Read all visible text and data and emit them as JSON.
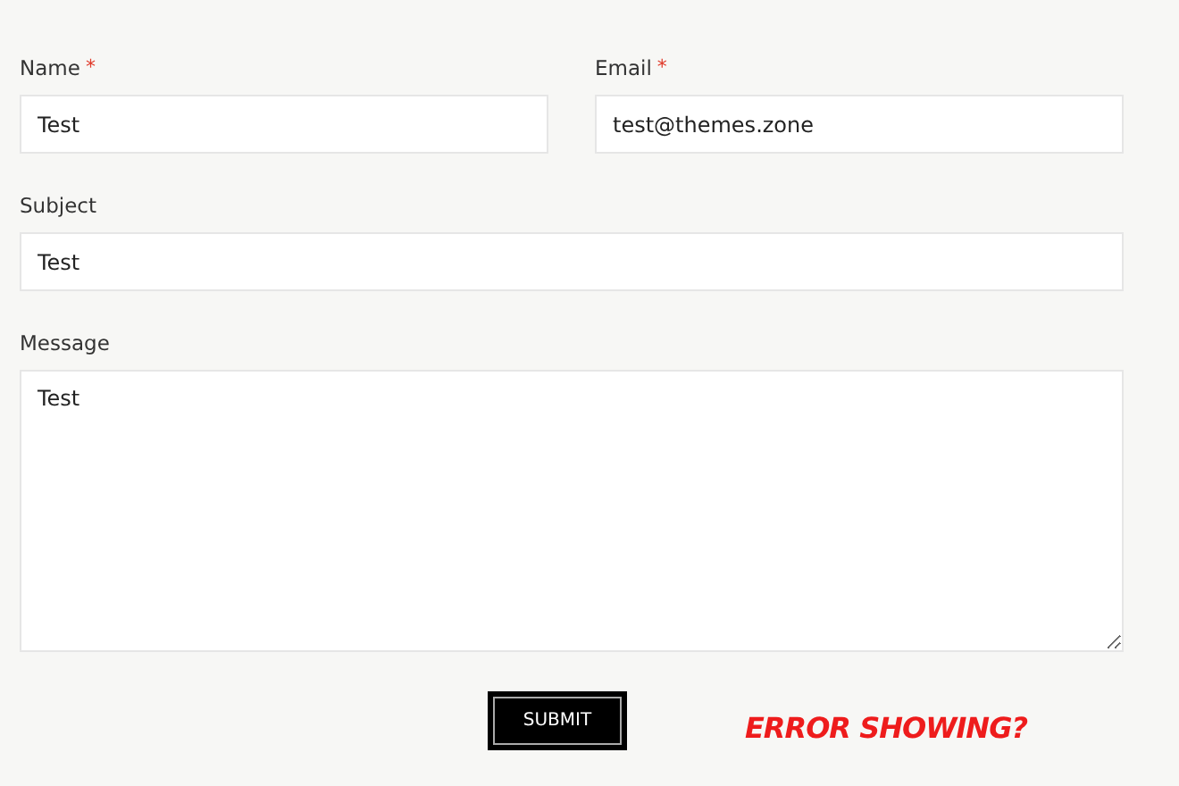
{
  "form": {
    "rows": [
      {
        "fields": [
          {
            "label": "Name",
            "required_mark": "*",
            "kind": "input",
            "value": "Test"
          },
          {
            "label": "Email",
            "required_mark": "*",
            "kind": "input",
            "value": "test@themes.zone"
          }
        ]
      },
      {
        "fields": [
          {
            "label": "Subject",
            "kind": "input",
            "value": "Test"
          }
        ]
      },
      {
        "fields": [
          {
            "label": "Message",
            "kind": "textarea",
            "value": "Test"
          }
        ]
      }
    ],
    "submit_button": "SUBMIT",
    "note": "ERROR SHOWING?"
  }
}
